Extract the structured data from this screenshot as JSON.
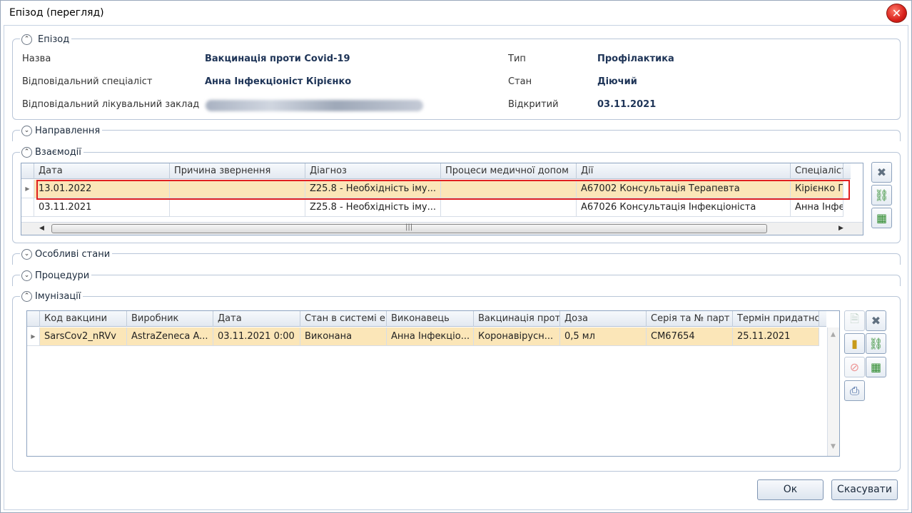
{
  "window": {
    "title": "Епізод (перегляд)"
  },
  "episode": {
    "section_title": "Епізод",
    "name_label": "Назва",
    "name_value": "Вакцинація проти Covid-19",
    "specialist_label": "Відповідальний спеціаліст",
    "specialist_value": "Анна Інфекціоніст Кірієнко",
    "facility_label": "Відповідальний лікувальний заклад",
    "type_label": "Тип",
    "type_value": "Профілактика",
    "state_label": "Стан",
    "state_value": "Діючий",
    "opened_label": "Відкритий",
    "opened_value": "03.11.2021"
  },
  "sections": {
    "referrals": "Направлення",
    "interactions": "Взаємодії",
    "special_states": "Особливі стани",
    "procedures": "Процедури",
    "immunizations": "Імунізації"
  },
  "interactions": {
    "columns": [
      "Дата",
      "Причина звернення",
      "Діагноз",
      "Процеси медичної допом",
      "Дії",
      "Спеціаліст"
    ],
    "rows": [
      [
        "13.01.2022",
        "",
        "Z25.8 - Необхідність іму...",
        "",
        "A67002 Консультація Терапевта",
        "Кірієнко П"
      ],
      [
        "03.11.2021",
        "",
        "Z25.8 - Необхідність іму...",
        "",
        "A67026 Консультація Інфекціоніста",
        "Анна Інфек"
      ]
    ]
  },
  "immunizations": {
    "columns": [
      "Код вакцини",
      "Виробник",
      "Дата",
      "Стан в системі е",
      "Виконавець",
      "Вакцинація прот",
      "Доза",
      "Серія та № парт",
      "Термін придатнс"
    ],
    "rows": [
      [
        "SarsCov2_nRVv",
        "AstraZeneca A...",
        "03.11.2021 0:00",
        "Виконана",
        "Анна Інфекціо...",
        "Коронавірусн...",
        "0,5 мл",
        "CM67654",
        "25.11.2021"
      ]
    ]
  },
  "buttons": {
    "ok": "Ок",
    "cancel": "Скасувати"
  },
  "colors": {
    "selected_row": "#fbe6b8",
    "highlight_box": "#e02020",
    "value_text": "#1e3457"
  }
}
